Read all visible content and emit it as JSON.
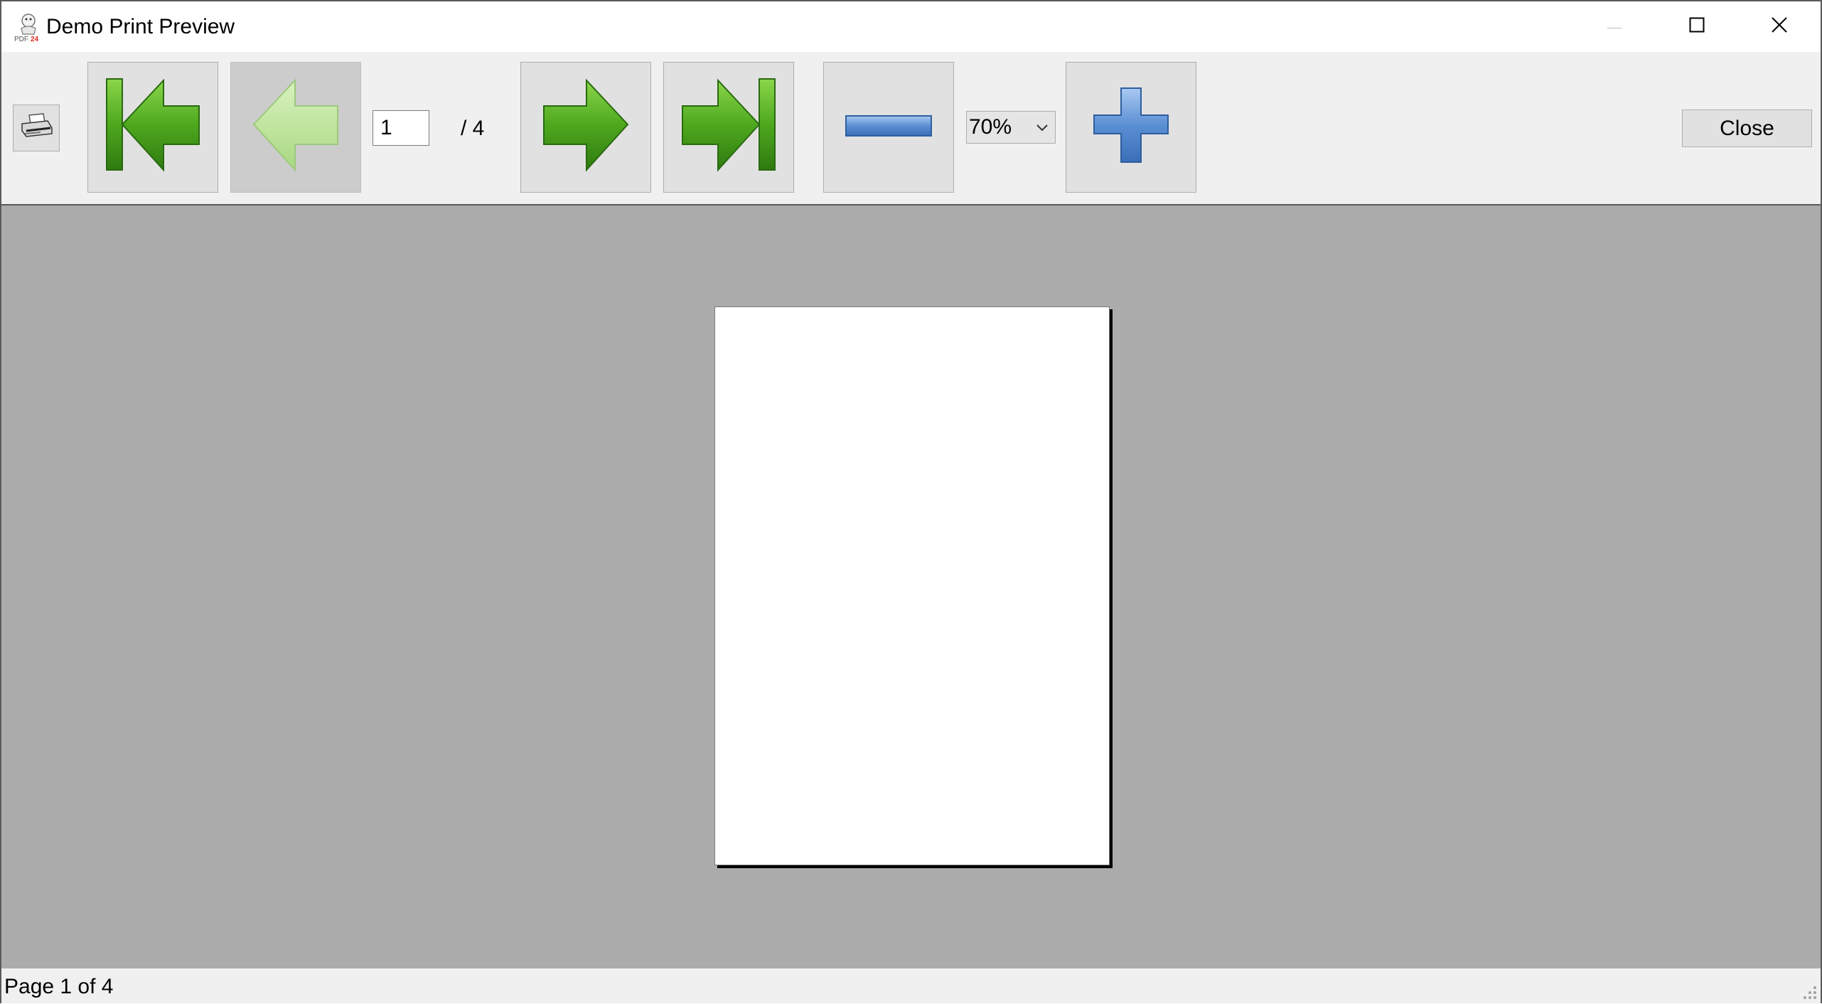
{
  "window": {
    "title": "Demo Print Preview",
    "app_icon_label": "PDF24"
  },
  "title_controls": {
    "minimize_icon": "minimize-icon",
    "maximize_icon": "maximize-icon",
    "close_icon": "close-icon"
  },
  "toolbar": {
    "print_icon": "printer-icon",
    "first_page_icon": "first-page-arrow-icon",
    "previous_page_icon": "previous-page-arrow-icon",
    "previous_page_disabled": true,
    "current_page": "1",
    "page_total": "/ 4",
    "next_page_icon": "next-page-arrow-icon",
    "last_page_icon": "last-page-arrow-icon",
    "zoom_out_icon": "minus-icon",
    "zoom_value": "70%",
    "zoom_in_icon": "plus-icon",
    "close_label": "Close"
  },
  "status": {
    "text": "Page 1 of 4"
  },
  "colors": {
    "arrow_green": "#4a9a1a",
    "arrow_green_light": "#bfe49a",
    "zoom_blue": "#5b8fd4",
    "preview_background": "#ababab",
    "page_background": "#ffffff"
  }
}
